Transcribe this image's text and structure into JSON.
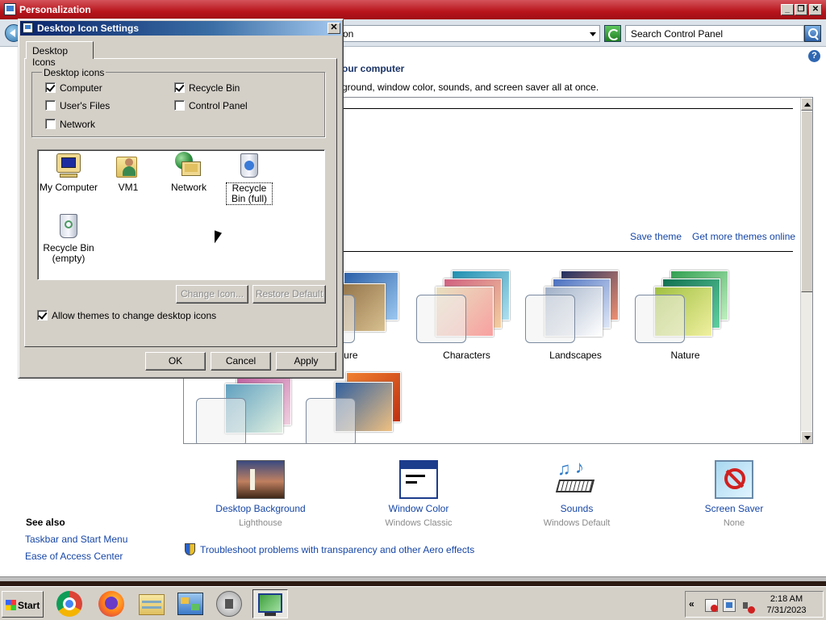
{
  "personalization": {
    "title": "Personalization",
    "address_text": "on",
    "search_placeholder": "Search Control Panel",
    "heading": "our computer",
    "subheading": "ground, window color, sounds, and screen saver all at once.",
    "save_theme": "Save theme",
    "get_more_themes": "Get more themes online",
    "themes": [
      {
        "label": "hitecture"
      },
      {
        "label": "Characters"
      },
      {
        "label": "Landscapes"
      },
      {
        "label": "Nature"
      },
      {
        "label": ""
      },
      {
        "label": ""
      }
    ],
    "tiles": [
      {
        "name": "Desktop Background",
        "sub": "Lighthouse",
        "icon": "lighthouse-wallpaper-icon"
      },
      {
        "name": "Window Color",
        "sub": "Windows Classic",
        "icon": "window-color-icon"
      },
      {
        "name": "Sounds",
        "sub": "Windows Default",
        "icon": "sounds-icon"
      },
      {
        "name": "Screen Saver",
        "sub": "None",
        "icon": "screen-saver-icon"
      }
    ],
    "see_also": {
      "title": "See also",
      "links": [
        "Taskbar and Start Menu",
        "Ease of Access Center"
      ]
    },
    "troubleshoot": "Troubleshoot problems with transparency and other Aero effects"
  },
  "dialog": {
    "title": "Desktop Icon Settings",
    "tab": "Desktop Icons",
    "group_label": "Desktop icons",
    "checkboxes": [
      {
        "label": "Computer",
        "checked": true
      },
      {
        "label": "Recycle Bin",
        "checked": true
      },
      {
        "label": "User's Files",
        "checked": false
      },
      {
        "label": "Control Panel",
        "checked": false
      },
      {
        "label": "Network",
        "checked": false
      }
    ],
    "icons": [
      {
        "label": "My Computer",
        "icon": "computer-icon"
      },
      {
        "label": "VM1",
        "icon": "user-folder-icon"
      },
      {
        "label": "Network",
        "icon": "network-icon"
      },
      {
        "label": "Recycle Bin (full)",
        "icon": "recycle-bin-full-icon"
      },
      {
        "label": "Recycle Bin (empty)",
        "icon": "recycle-bin-empty-icon"
      }
    ],
    "change_icon": "Change Icon...",
    "restore_default": "Restore Default",
    "allow_themes": "Allow themes to change desktop icons",
    "allow_themes_checked": true,
    "ok": "OK",
    "cancel": "Cancel",
    "apply": "Apply"
  },
  "taskbar": {
    "start": "Start",
    "apps": [
      "chrome-icon",
      "firefox-icon",
      "file-explorer-icon",
      "control-panel-icon",
      "media-player-icon",
      "personalization-icon"
    ],
    "tray_chevron": "«",
    "time": "2:18 AM",
    "date": "7/31/2023"
  },
  "colors": {
    "title_red": "#b8141c",
    "dialog_title": "#0a246a",
    "link_blue": "#1646a6",
    "classic_face": "#d4d0c8"
  }
}
